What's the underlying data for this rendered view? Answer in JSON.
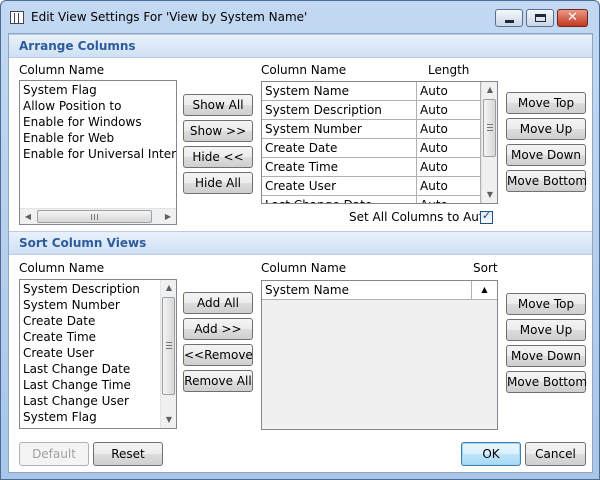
{
  "window": {
    "title": "Edit View Settings For 'View by System Name'"
  },
  "arrange": {
    "header": "Arrange Columns",
    "available_label": "Column Name",
    "available_items": [
      "System Flag",
      "Allow Position to",
      "Enable for Windows",
      "Enable for Web",
      "Enable for Universal Interface"
    ],
    "buttons": {
      "show_all": "Show All",
      "show": "Show >>",
      "hide": "Hide <<",
      "hide_all": "Hide All"
    },
    "grid_col_name": "Column Name",
    "grid_col_length": "Length",
    "grid_rows": [
      {
        "name": "System Name",
        "length": "Auto"
      },
      {
        "name": "System Description",
        "length": "Auto"
      },
      {
        "name": "System Number",
        "length": "Auto"
      },
      {
        "name": "Create Date",
        "length": "Auto"
      },
      {
        "name": "Create Time",
        "length": "Auto"
      },
      {
        "name": "Create User",
        "length": "Auto"
      },
      {
        "name": "Last Change Date",
        "length": "Auto"
      }
    ],
    "set_all_auto_label": "Set All Columns to Auto",
    "set_all_auto_checked": true,
    "move": {
      "top": "Move Top",
      "up": "Move Up",
      "down": "Move Down",
      "bottom": "Move Bottom"
    }
  },
  "sort": {
    "header": "Sort Column Views",
    "available_label": "Column Name",
    "available_items": [
      "System Description",
      "System Number",
      "Create Date",
      "Create Time",
      "Create User",
      "Last Change Date",
      "Last Change Time",
      "Last Change User",
      "System Flag"
    ],
    "buttons": {
      "add_all": "Add All",
      "add": "Add >>",
      "remove": "<<Remove",
      "remove_all": "Remove All"
    },
    "grid_col_name": "Column Name",
    "grid_col_sort": "Sort",
    "grid_rows": [
      {
        "name": "System Name",
        "direction": "ascending"
      }
    ],
    "move": {
      "top": "Move Top",
      "up": "Move Up",
      "down": "Move Down",
      "bottom": "Move Bottom"
    }
  },
  "footer": {
    "default": "Default",
    "reset": "Reset",
    "ok": "OK",
    "cancel": "Cancel"
  },
  "icons": {
    "app": "table-icon",
    "minimize": "minimize-icon",
    "maximize": "maximize-icon",
    "close": "close-icon"
  }
}
